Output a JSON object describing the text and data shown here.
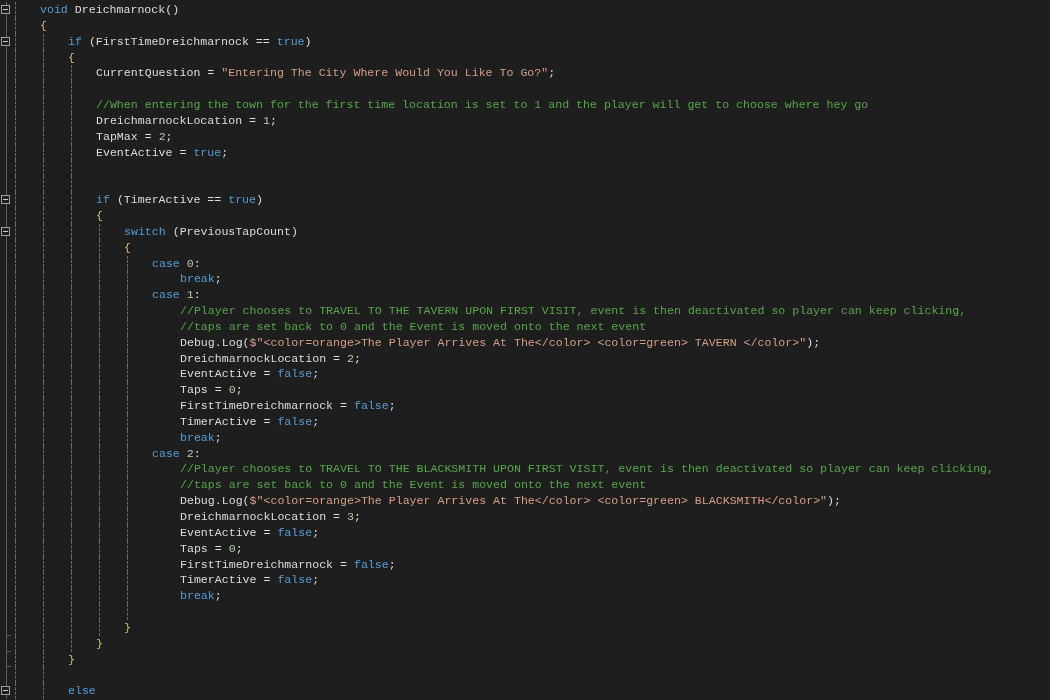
{
  "editor": {
    "lines": [
      {
        "kind": "line",
        "collapsible": true,
        "tokens": [
          {
            "kind": "kw",
            "text": "void"
          },
          {
            "kind": "id",
            "text": " Dreichmarnock()"
          }
        ]
      },
      {
        "kind": "line",
        "tokens": [
          {
            "kind": "brace",
            "text": "{"
          }
        ]
      },
      {
        "kind": "block",
        "children": [
          {
            "kind": "line",
            "collapsible": true,
            "tokens": [
              {
                "kind": "kw",
                "text": "if"
              },
              {
                "kind": "id",
                "text": " (FirstTimeDreichmarnock == "
              },
              {
                "kind": "kw",
                "text": "true"
              },
              {
                "kind": "id",
                "text": ")"
              }
            ]
          },
          {
            "kind": "line",
            "tokens": [
              {
                "kind": "brace",
                "text": "{"
              }
            ]
          },
          {
            "kind": "block",
            "children": [
              {
                "kind": "line",
                "tokens": [
                  {
                    "kind": "id",
                    "text": "CurrentQuestion = "
                  },
                  {
                    "kind": "str",
                    "text": "\"Entering The City Where Would You Like To Go?\""
                  },
                  {
                    "kind": "id",
                    "text": ";"
                  }
                ]
              },
              {
                "kind": "line"
              },
              {
                "kind": "line",
                "tokens": [
                  {
                    "kind": "com",
                    "text": "//When entering the town for the first time location is set to 1 and the player will get to choose where hey go"
                  }
                ]
              },
              {
                "kind": "line",
                "tokens": [
                  {
                    "kind": "id",
                    "text": "DreichmarnockLocation = "
                  },
                  {
                    "kind": "num",
                    "text": "1"
                  },
                  {
                    "kind": "id",
                    "text": ";"
                  }
                ]
              },
              {
                "kind": "line",
                "tokens": [
                  {
                    "kind": "id",
                    "text": "TapMax = "
                  },
                  {
                    "kind": "num",
                    "text": "2"
                  },
                  {
                    "kind": "id",
                    "text": ";"
                  }
                ]
              },
              {
                "kind": "line",
                "tokens": [
                  {
                    "kind": "id",
                    "text": "EventActive = "
                  },
                  {
                    "kind": "kw",
                    "text": "true"
                  },
                  {
                    "kind": "id",
                    "text": ";"
                  }
                ]
              },
              {
                "kind": "line"
              },
              {
                "kind": "line"
              },
              {
                "kind": "line",
                "collapsible": true,
                "tokens": [
                  {
                    "kind": "kw",
                    "text": "if"
                  },
                  {
                    "kind": "id",
                    "text": " (TimerActive == "
                  },
                  {
                    "kind": "kw",
                    "text": "true"
                  },
                  {
                    "kind": "id",
                    "text": ")"
                  }
                ]
              },
              {
                "kind": "line",
                "tokens": [
                  {
                    "kind": "brace",
                    "text": "{"
                  }
                ]
              },
              {
                "kind": "block",
                "children": [
                  {
                    "kind": "line",
                    "collapsible": true,
                    "tokens": [
                      {
                        "kind": "kw",
                        "text": "switch"
                      },
                      {
                        "kind": "id",
                        "text": " (PreviousTapCount)"
                      }
                    ]
                  },
                  {
                    "kind": "line",
                    "tokens": [
                      {
                        "kind": "brace",
                        "text": "{"
                      }
                    ]
                  },
                  {
                    "kind": "block",
                    "children": [
                      {
                        "kind": "line",
                        "tokens": [
                          {
                            "kind": "kw",
                            "text": "case "
                          },
                          {
                            "kind": "num",
                            "text": "0"
                          },
                          {
                            "kind": "id",
                            "text": ":"
                          }
                        ]
                      },
                      {
                        "kind": "indent",
                        "children": [
                          {
                            "kind": "line",
                            "tokens": [
                              {
                                "kind": "kw",
                                "text": "break"
                              },
                              {
                                "kind": "id",
                                "text": ";"
                              }
                            ]
                          }
                        ]
                      },
                      {
                        "kind": "line",
                        "tokens": [
                          {
                            "kind": "kw",
                            "text": "case "
                          },
                          {
                            "kind": "num",
                            "text": "1"
                          },
                          {
                            "kind": "id",
                            "text": ":"
                          }
                        ]
                      },
                      {
                        "kind": "indent",
                        "children": [
                          {
                            "kind": "line",
                            "tokens": [
                              {
                                "kind": "com",
                                "text": "//Player chooses to TRAVEL TO THE TAVERN UPON FIRST VISIT, event is then deactivated so player can keep clicking,"
                              }
                            ]
                          },
                          {
                            "kind": "line",
                            "tokens": [
                              {
                                "kind": "com",
                                "text": "//taps are set back to 0 and the Event is moved onto the next event"
                              }
                            ]
                          },
                          {
                            "kind": "line",
                            "tokens": [
                              {
                                "kind": "id",
                                "text": "Debug.Log("
                              },
                              {
                                "kind": "str",
                                "text": "$\"<color=orange>The Player Arrives At The</color> <color=green> TAVERN </color>\""
                              },
                              {
                                "kind": "id",
                                "text": ");"
                              }
                            ]
                          },
                          {
                            "kind": "line",
                            "tokens": [
                              {
                                "kind": "id",
                                "text": "DreichmarnockLocation = "
                              },
                              {
                                "kind": "num",
                                "text": "2"
                              },
                              {
                                "kind": "id",
                                "text": ";"
                              }
                            ]
                          },
                          {
                            "kind": "line",
                            "tokens": [
                              {
                                "kind": "id",
                                "text": "EventActive = "
                              },
                              {
                                "kind": "kw",
                                "text": "false"
                              },
                              {
                                "kind": "id",
                                "text": ";"
                              }
                            ]
                          },
                          {
                            "kind": "line",
                            "tokens": [
                              {
                                "kind": "id",
                                "text": "Taps = "
                              },
                              {
                                "kind": "num",
                                "text": "0"
                              },
                              {
                                "kind": "id",
                                "text": ";"
                              }
                            ]
                          },
                          {
                            "kind": "line",
                            "tokens": [
                              {
                                "kind": "id",
                                "text": "FirstTimeDreichmarnock = "
                              },
                              {
                                "kind": "kw",
                                "text": "false"
                              },
                              {
                                "kind": "id",
                                "text": ";"
                              }
                            ]
                          },
                          {
                            "kind": "line",
                            "tokens": [
                              {
                                "kind": "id",
                                "text": "TimerActive = "
                              },
                              {
                                "kind": "kw",
                                "text": "false"
                              },
                              {
                                "kind": "id",
                                "text": ";"
                              }
                            ]
                          },
                          {
                            "kind": "line",
                            "tokens": [
                              {
                                "kind": "kw",
                                "text": "break"
                              },
                              {
                                "kind": "id",
                                "text": ";"
                              }
                            ]
                          }
                        ]
                      },
                      {
                        "kind": "line",
                        "tokens": [
                          {
                            "kind": "kw",
                            "text": "case "
                          },
                          {
                            "kind": "num",
                            "text": "2"
                          },
                          {
                            "kind": "id",
                            "text": ":"
                          }
                        ]
                      },
                      {
                        "kind": "indent",
                        "children": [
                          {
                            "kind": "line",
                            "tokens": [
                              {
                                "kind": "com",
                                "text": "//Player chooses to TRAVEL TO THE BLACKSMITH UPON FIRST VISIT, event is then deactivated so player can keep clicking,"
                              }
                            ]
                          },
                          {
                            "kind": "line",
                            "tokens": [
                              {
                                "kind": "com",
                                "text": "//taps are set back to 0 and the Event is moved onto the next event"
                              }
                            ]
                          },
                          {
                            "kind": "line",
                            "tokens": [
                              {
                                "kind": "id",
                                "text": "Debug.Log("
                              },
                              {
                                "kind": "str",
                                "text": "$\"<color=orange>The Player Arrives At The</color> <color=green> BLACKSMITH</color>\""
                              },
                              {
                                "kind": "id",
                                "text": ");"
                              }
                            ]
                          },
                          {
                            "kind": "line",
                            "tokens": [
                              {
                                "kind": "id",
                                "text": "DreichmarnockLocation = "
                              },
                              {
                                "kind": "num",
                                "text": "3"
                              },
                              {
                                "kind": "id",
                                "text": ";"
                              }
                            ]
                          },
                          {
                            "kind": "line",
                            "tokens": [
                              {
                                "kind": "id",
                                "text": "EventActive = "
                              },
                              {
                                "kind": "kw",
                                "text": "false"
                              },
                              {
                                "kind": "id",
                                "text": ";"
                              }
                            ]
                          },
                          {
                            "kind": "line",
                            "tokens": [
                              {
                                "kind": "id",
                                "text": "Taps = "
                              },
                              {
                                "kind": "num",
                                "text": "0"
                              },
                              {
                                "kind": "id",
                                "text": ";"
                              }
                            ]
                          },
                          {
                            "kind": "line",
                            "tokens": [
                              {
                                "kind": "id",
                                "text": "FirstTimeDreichmarnock = "
                              },
                              {
                                "kind": "kw",
                                "text": "false"
                              },
                              {
                                "kind": "id",
                                "text": ";"
                              }
                            ]
                          },
                          {
                            "kind": "line",
                            "tokens": [
                              {
                                "kind": "id",
                                "text": "TimerActive = "
                              },
                              {
                                "kind": "kw",
                                "text": "false"
                              },
                              {
                                "kind": "id",
                                "text": ";"
                              }
                            ]
                          },
                          {
                            "kind": "line",
                            "tokens": [
                              {
                                "kind": "kw",
                                "text": "break"
                              },
                              {
                                "kind": "id",
                                "text": ";"
                              }
                            ]
                          }
                        ]
                      },
                      {
                        "kind": "line"
                      }
                    ]
                  },
                  {
                    "kind": "line",
                    "fold_end": true,
                    "tokens": [
                      {
                        "kind": "brace",
                        "text": "}"
                      }
                    ]
                  }
                ]
              },
              {
                "kind": "line",
                "fold_end": true,
                "tokens": [
                  {
                    "kind": "brace",
                    "text": "}"
                  }
                ]
              }
            ]
          },
          {
            "kind": "line",
            "fold_end": true,
            "tokens": [
              {
                "kind": "brace",
                "text": "}"
              }
            ]
          },
          {
            "kind": "line"
          },
          {
            "kind": "line",
            "collapsible": true,
            "tokens": [
              {
                "kind": "kw",
                "text": "else"
              }
            ]
          }
        ]
      }
    ]
  }
}
